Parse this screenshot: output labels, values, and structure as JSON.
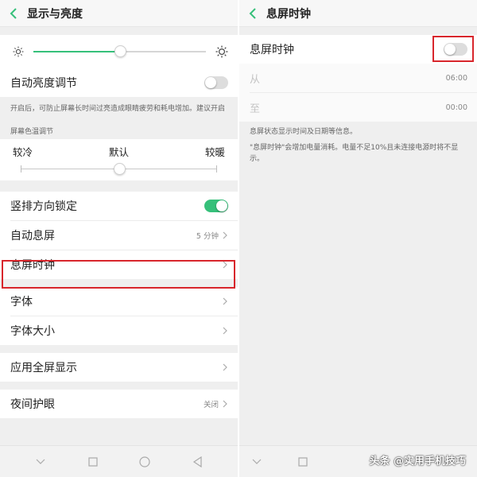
{
  "left": {
    "title": "显示与亮度",
    "brightness": {
      "level": 0.5,
      "auto_label": "自动亮度调节",
      "auto_enabled": false
    },
    "note": "开启后，可防止屏幕长时间过亮造成眼睛疲劳和耗电增加。建议开启",
    "color_temp": {
      "section_label": "屏幕色温调节",
      "cool": "较冷",
      "default": "默认",
      "warm": "较暖",
      "level": 0.5
    },
    "items": [
      {
        "label": "竖排方向锁定",
        "toggle": true
      },
      {
        "label": "自动息屏",
        "value": "5 分钟"
      },
      {
        "label": "息屏时钟"
      }
    ],
    "items2": [
      {
        "label": "字体"
      },
      {
        "label": "字体大小"
      }
    ],
    "items3": [
      {
        "label": "应用全屏显示"
      }
    ],
    "items4": [
      {
        "label": "夜间护眼",
        "value": "关闭"
      }
    ]
  },
  "right": {
    "title": "息屏时钟",
    "clock_label": "息屏时钟",
    "clock_enabled": false,
    "from_label": "从",
    "from_value": "06:00",
    "to_label": "至",
    "to_value": "00:00",
    "note1": "息屏状态显示时间及日期等信息。",
    "note2": "\"息屏时钟\"会增加电量消耗。电量不足10%且未连接电源时将不显示。"
  },
  "colors": {
    "accent": "#36c07a",
    "highlight": "#d8262c"
  },
  "watermark": "头条 @实用手机技巧"
}
